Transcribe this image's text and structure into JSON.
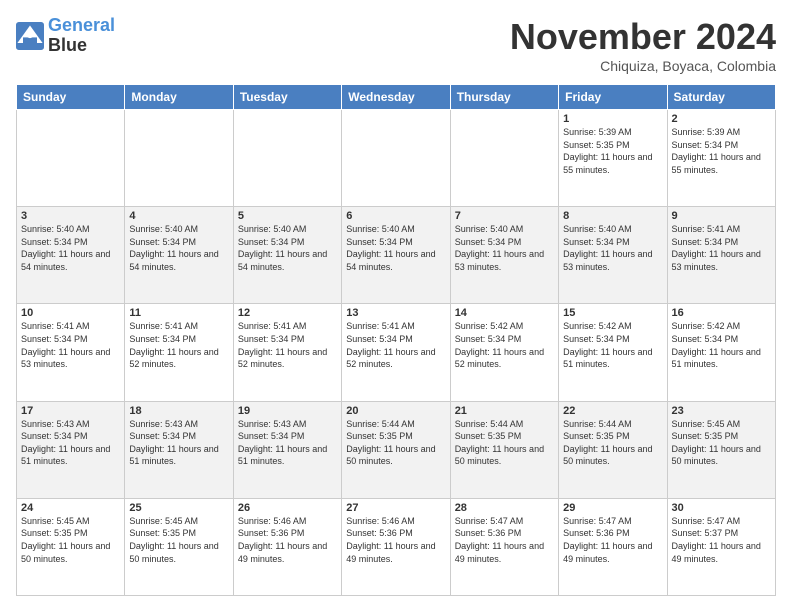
{
  "logo": {
    "line1": "General",
    "line2": "Blue"
  },
  "title": "November 2024",
  "location": "Chiquiza, Boyaca, Colombia",
  "days_of_week": [
    "Sunday",
    "Monday",
    "Tuesday",
    "Wednesday",
    "Thursday",
    "Friday",
    "Saturday"
  ],
  "weeks": [
    [
      {
        "day": "",
        "info": ""
      },
      {
        "day": "",
        "info": ""
      },
      {
        "day": "",
        "info": ""
      },
      {
        "day": "",
        "info": ""
      },
      {
        "day": "",
        "info": ""
      },
      {
        "day": "1",
        "info": "Sunrise: 5:39 AM\nSunset: 5:35 PM\nDaylight: 11 hours\nand 55 minutes."
      },
      {
        "day": "2",
        "info": "Sunrise: 5:39 AM\nSunset: 5:34 PM\nDaylight: 11 hours\nand 55 minutes."
      }
    ],
    [
      {
        "day": "3",
        "info": "Sunrise: 5:40 AM\nSunset: 5:34 PM\nDaylight: 11 hours\nand 54 minutes."
      },
      {
        "day": "4",
        "info": "Sunrise: 5:40 AM\nSunset: 5:34 PM\nDaylight: 11 hours\nand 54 minutes."
      },
      {
        "day": "5",
        "info": "Sunrise: 5:40 AM\nSunset: 5:34 PM\nDaylight: 11 hours\nand 54 minutes."
      },
      {
        "day": "6",
        "info": "Sunrise: 5:40 AM\nSunset: 5:34 PM\nDaylight: 11 hours\nand 54 minutes."
      },
      {
        "day": "7",
        "info": "Sunrise: 5:40 AM\nSunset: 5:34 PM\nDaylight: 11 hours\nand 53 minutes."
      },
      {
        "day": "8",
        "info": "Sunrise: 5:40 AM\nSunset: 5:34 PM\nDaylight: 11 hours\nand 53 minutes."
      },
      {
        "day": "9",
        "info": "Sunrise: 5:41 AM\nSunset: 5:34 PM\nDaylight: 11 hours\nand 53 minutes."
      }
    ],
    [
      {
        "day": "10",
        "info": "Sunrise: 5:41 AM\nSunset: 5:34 PM\nDaylight: 11 hours\nand 53 minutes."
      },
      {
        "day": "11",
        "info": "Sunrise: 5:41 AM\nSunset: 5:34 PM\nDaylight: 11 hours\nand 52 minutes."
      },
      {
        "day": "12",
        "info": "Sunrise: 5:41 AM\nSunset: 5:34 PM\nDaylight: 11 hours\nand 52 minutes."
      },
      {
        "day": "13",
        "info": "Sunrise: 5:41 AM\nSunset: 5:34 PM\nDaylight: 11 hours\nand 52 minutes."
      },
      {
        "day": "14",
        "info": "Sunrise: 5:42 AM\nSunset: 5:34 PM\nDaylight: 11 hours\nand 52 minutes."
      },
      {
        "day": "15",
        "info": "Sunrise: 5:42 AM\nSunset: 5:34 PM\nDaylight: 11 hours\nand 51 minutes."
      },
      {
        "day": "16",
        "info": "Sunrise: 5:42 AM\nSunset: 5:34 PM\nDaylight: 11 hours\nand 51 minutes."
      }
    ],
    [
      {
        "day": "17",
        "info": "Sunrise: 5:43 AM\nSunset: 5:34 PM\nDaylight: 11 hours\nand 51 minutes."
      },
      {
        "day": "18",
        "info": "Sunrise: 5:43 AM\nSunset: 5:34 PM\nDaylight: 11 hours\nand 51 minutes."
      },
      {
        "day": "19",
        "info": "Sunrise: 5:43 AM\nSunset: 5:34 PM\nDaylight: 11 hours\nand 51 minutes."
      },
      {
        "day": "20",
        "info": "Sunrise: 5:44 AM\nSunset: 5:35 PM\nDaylight: 11 hours\nand 50 minutes."
      },
      {
        "day": "21",
        "info": "Sunrise: 5:44 AM\nSunset: 5:35 PM\nDaylight: 11 hours\nand 50 minutes."
      },
      {
        "day": "22",
        "info": "Sunrise: 5:44 AM\nSunset: 5:35 PM\nDaylight: 11 hours\nand 50 minutes."
      },
      {
        "day": "23",
        "info": "Sunrise: 5:45 AM\nSunset: 5:35 PM\nDaylight: 11 hours\nand 50 minutes."
      }
    ],
    [
      {
        "day": "24",
        "info": "Sunrise: 5:45 AM\nSunset: 5:35 PM\nDaylight: 11 hours\nand 50 minutes."
      },
      {
        "day": "25",
        "info": "Sunrise: 5:45 AM\nSunset: 5:35 PM\nDaylight: 11 hours\nand 50 minutes."
      },
      {
        "day": "26",
        "info": "Sunrise: 5:46 AM\nSunset: 5:36 PM\nDaylight: 11 hours\nand 49 minutes."
      },
      {
        "day": "27",
        "info": "Sunrise: 5:46 AM\nSunset: 5:36 PM\nDaylight: 11 hours\nand 49 minutes."
      },
      {
        "day": "28",
        "info": "Sunrise: 5:47 AM\nSunset: 5:36 PM\nDaylight: 11 hours\nand 49 minutes."
      },
      {
        "day": "29",
        "info": "Sunrise: 5:47 AM\nSunset: 5:36 PM\nDaylight: 11 hours\nand 49 minutes."
      },
      {
        "day": "30",
        "info": "Sunrise: 5:47 AM\nSunset: 5:37 PM\nDaylight: 11 hours\nand 49 minutes."
      }
    ]
  ]
}
